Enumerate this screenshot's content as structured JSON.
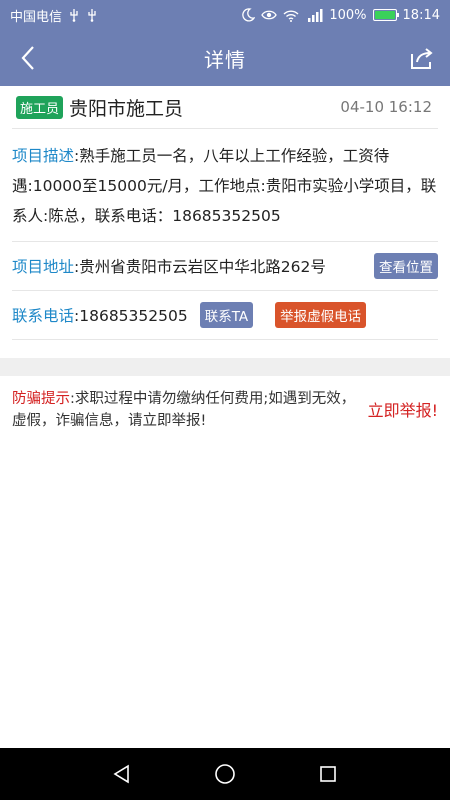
{
  "status_bar": {
    "carrier": "中国电信",
    "left_icons": [
      "usb-icon",
      "usb-icon"
    ],
    "right_icons": [
      "moon-icon",
      "eye-icon",
      "wifi-icon",
      "signal-icon"
    ],
    "battery": "100%",
    "time": "18:14"
  },
  "nav": {
    "title": "详情"
  },
  "job": {
    "tag": "施工员",
    "title": "贵阳市施工员",
    "time": "04-10 16:12",
    "desc_label": "项目描述",
    "desc_text": ":熟手施工员一名，八年以上工作经验，工资待遇:10000至15000元/月，工作地点:贵阳市实验小学项目，联系人:陈总，联系电话：18685352505",
    "addr_label": "项目地址",
    "addr_text": ":贵州省贵阳市云岩区中华北路262号",
    "view_location": "查看位置",
    "phone_label": "联系电话",
    "phone_text": ":18685352505",
    "contact_button": "联系TA",
    "report_button": "举报虚假电话"
  },
  "warning": {
    "label": "防骗提示",
    "text": ":求职过程中请勿缴纳任何费用;如遇到无效，虚假，诈骗信息，请立即举报!",
    "action": "立即举报!"
  },
  "colors": {
    "primary": "#6d7fb3",
    "tag_green": "#1fa35a",
    "label_blue": "#1e88c8",
    "report_red": "#d9542b",
    "warning_red": "#d42222"
  }
}
